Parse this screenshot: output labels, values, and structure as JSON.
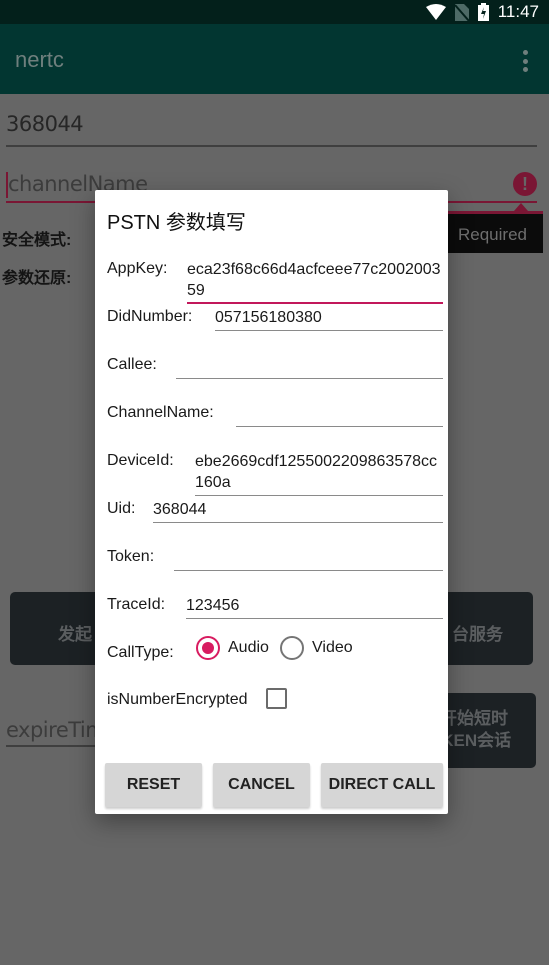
{
  "status_bar": {
    "time": "11:47",
    "icons": [
      "wifi-icon",
      "no-sim-icon",
      "battery-charging-icon"
    ]
  },
  "app_bar": {
    "title": "nertc",
    "menu_icon": "overflow-menu-icon"
  },
  "background": {
    "uid_value": "368044",
    "channel_placeholder": "channelName",
    "channel_error": "Required",
    "security_mode_label": "安全模式:",
    "param_restore_label": "参数还原:",
    "left_button_label": "发起",
    "right_button1_label": "台服务",
    "right_button2_label_line1": "开始短时",
    "right_button2_label_line2": "OKEN会话",
    "expire_placeholder": "expireTim"
  },
  "dialog": {
    "title": "PSTN 参数填写",
    "fields": {
      "appkey": {
        "label": "AppKey:",
        "value": "eca23f68c66d4acfceee77c200200359"
      },
      "did_number": {
        "label": "DidNumber:",
        "value": "057156180380"
      },
      "callee": {
        "label": "Callee:",
        "value": ""
      },
      "channel_name": {
        "label": "ChannelName:",
        "value": ""
      },
      "device_id": {
        "label": "DeviceId:",
        "value": "ebe2669cdf1255002209863578cc160a"
      },
      "uid": {
        "label": "Uid:",
        "value": "368044"
      },
      "token": {
        "label": "Token:",
        "value": ""
      },
      "trace_id": {
        "label": "TraceId:",
        "value": "123456"
      }
    },
    "call_type": {
      "label": "CallType:",
      "options": [
        {
          "label": "Audio",
          "selected": true
        },
        {
          "label": "Video",
          "selected": false
        }
      ]
    },
    "number_encrypted": {
      "label": "isNumberEncrypted",
      "checked": false
    },
    "buttons": {
      "reset": "RESET",
      "cancel": "CANCEL",
      "direct_call": "DIRECT CALL"
    }
  },
  "colors": {
    "accent": "#d81b60",
    "app_bar": "#023631",
    "status_bar": "#03201b",
    "scrim": "#666666"
  }
}
